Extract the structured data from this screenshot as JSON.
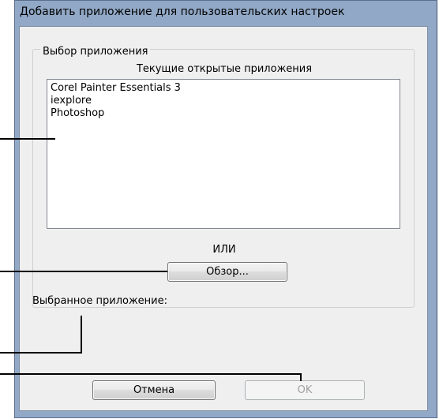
{
  "dialog": {
    "title": "Добавить приложение для пользовательских настроек"
  },
  "group": {
    "label": "Выбор приложения",
    "list_caption": "Текущие открытые приложения",
    "applications": [
      "Corel Painter Essentials 3",
      "iexplore",
      "Photoshop"
    ],
    "or_label": "ИЛИ",
    "browse_label": "Обзор..."
  },
  "selected": {
    "label": "Выбранное приложение:"
  },
  "buttons": {
    "cancel_label": "Отмена",
    "ok_label": "OK"
  }
}
